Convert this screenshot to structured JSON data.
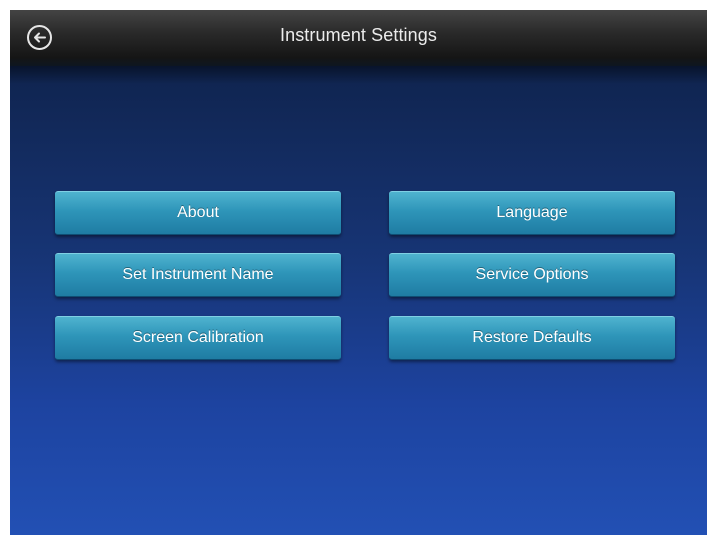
{
  "header": {
    "title": "Instrument Settings",
    "back_icon": "back-arrow-icon"
  },
  "buttons": {
    "about": "About",
    "language": "Language",
    "set_instrument_name": "Set Instrument Name",
    "service_options": "Service Options",
    "screen_calibration": "Screen Calibration",
    "restore_defaults": "Restore Defaults"
  },
  "colors": {
    "header": "#1c1c1c",
    "background_top": "#0c1e44",
    "background_bottom": "#2250b4",
    "button": "#2e95b9",
    "button_text": "#ffffff"
  }
}
